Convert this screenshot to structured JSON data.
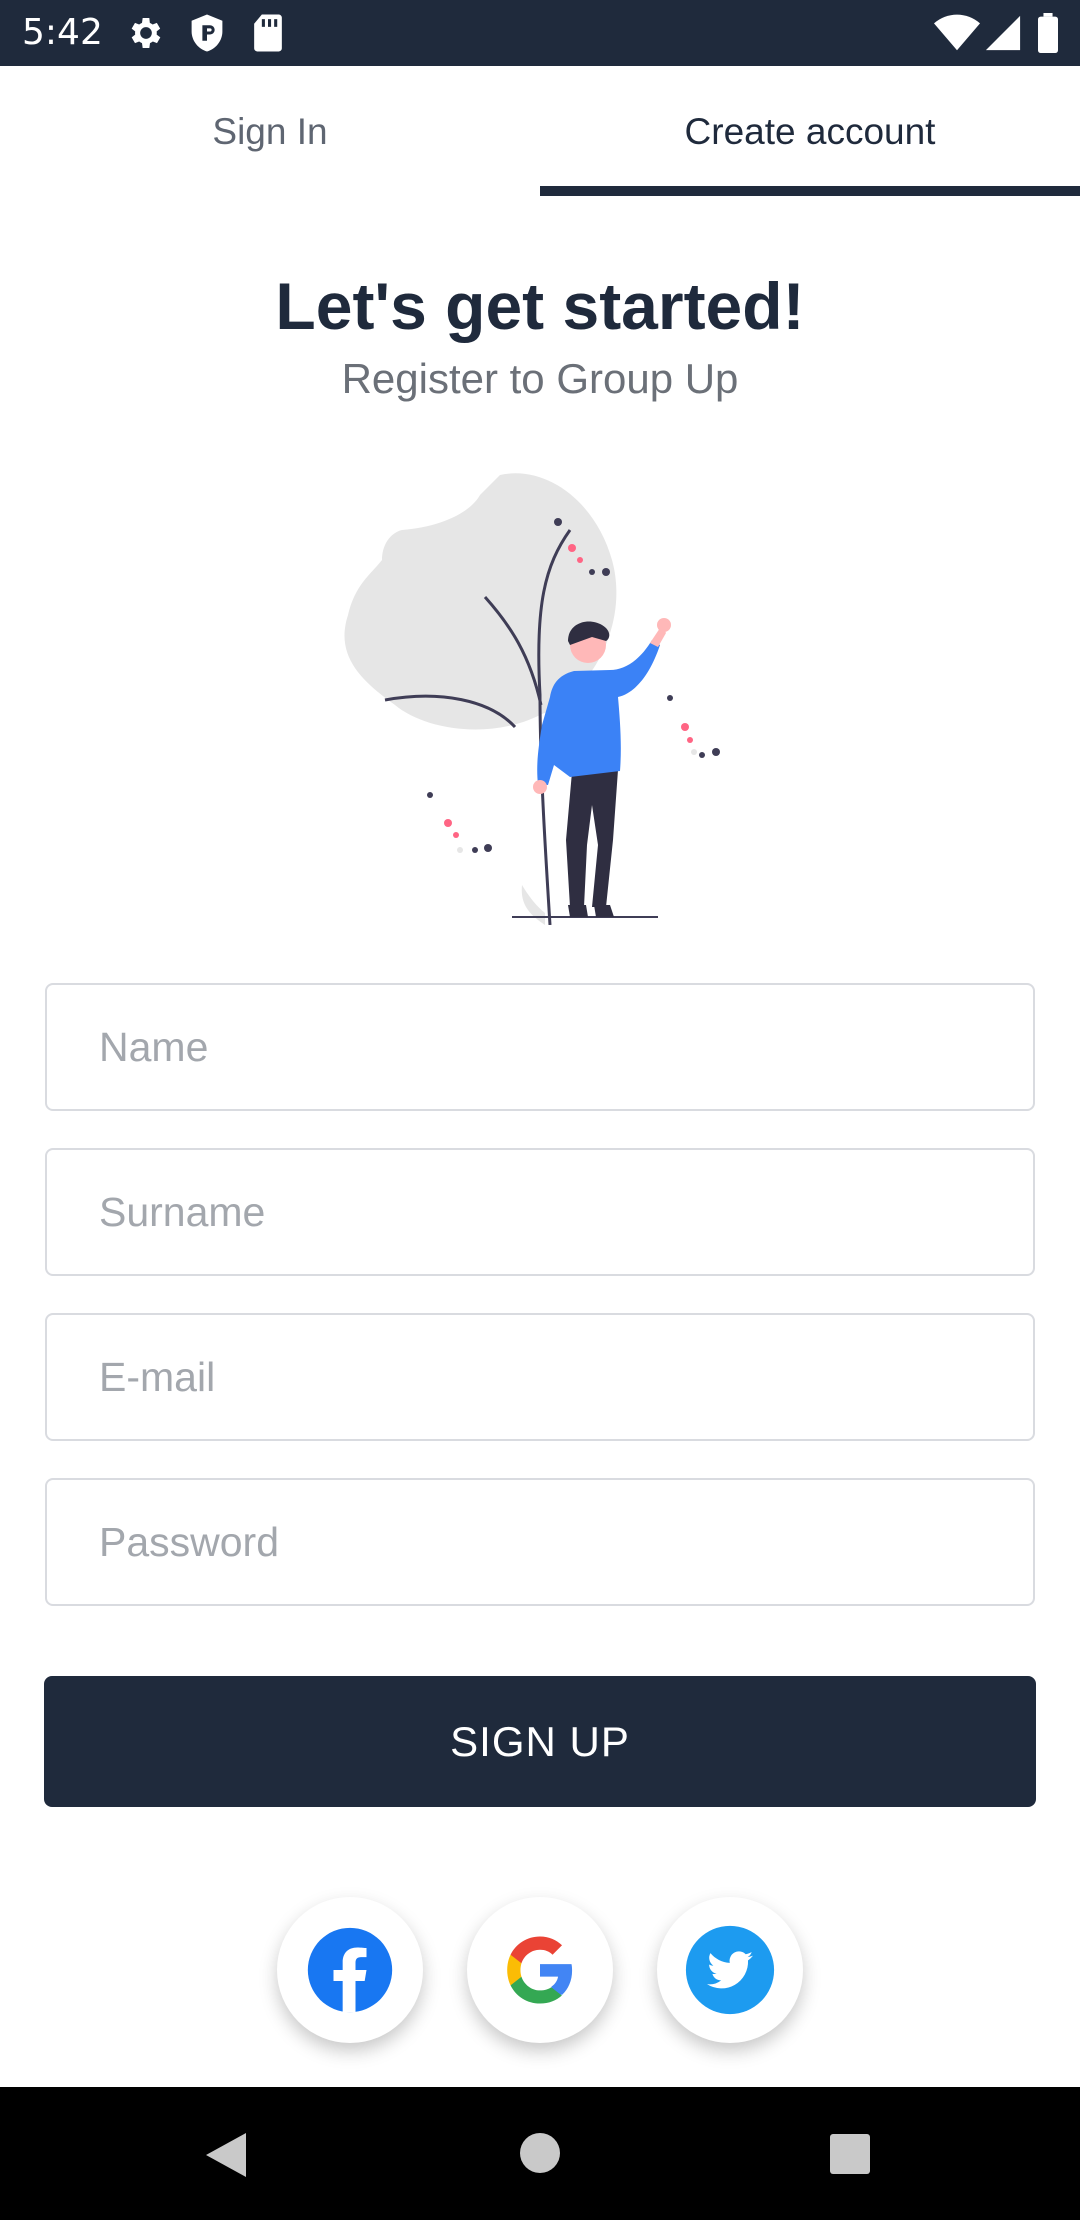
{
  "status_bar": {
    "time": "5:42",
    "icons": [
      "gear-icon",
      "shield-icon",
      "sd-card-icon",
      "wifi-icon",
      "signal-icon",
      "battery-icon"
    ]
  },
  "tabs": [
    {
      "label": "Sign In",
      "selected": false
    },
    {
      "label": "Create account",
      "selected": true
    }
  ],
  "heading": "Let's get started!",
  "subheading": "Register to Group Up",
  "form": {
    "name_placeholder": "Name",
    "surname_placeholder": "Surname",
    "email_placeholder": "E-mail",
    "password_placeholder": "Password",
    "submit_label": "SIGN UP"
  },
  "social_buttons": [
    "facebook-icon",
    "google-icon",
    "twitter-icon"
  ],
  "colors": {
    "primary": "#1f2a3c",
    "accent_blue": "#4285f4",
    "facebook": "#1877f2",
    "twitter": "#1d9bf0"
  },
  "nav_bar": [
    "back-icon",
    "home-icon",
    "recents-icon"
  ]
}
